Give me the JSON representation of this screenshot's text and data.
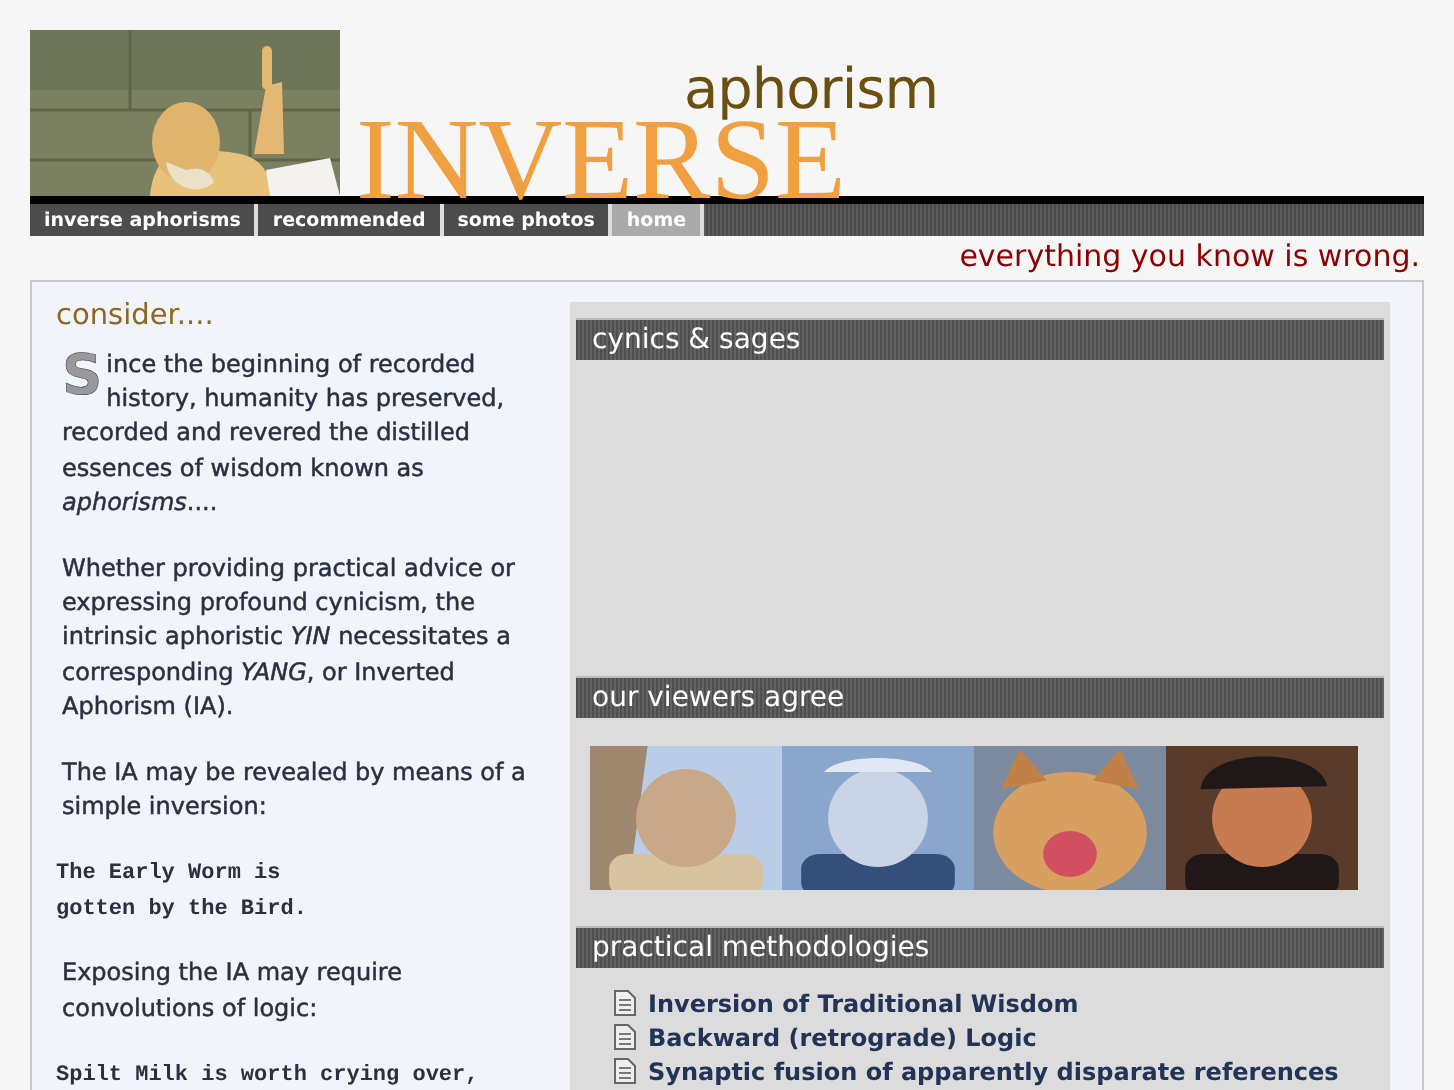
{
  "header": {
    "logo_small": "aphorism",
    "logo_large": "INVERSE",
    "tagline": "everything you know is wrong.",
    "nav": [
      {
        "label": "inverse aphorisms",
        "selected": false
      },
      {
        "label": "recommended",
        "selected": false
      },
      {
        "label": "some photos",
        "selected": false
      },
      {
        "label": "home",
        "selected": true
      }
    ]
  },
  "consider": {
    "title": "consider....",
    "paragraphs": [
      {
        "kind": "dropcap",
        "initial": "S",
        "text": "ince the beginning of recorded history, humanity has preserved, recorded and revered the distilled essences of wisdom known as *aphorisms*...."
      },
      {
        "kind": "text",
        "text": "Whether providing practical advice or expressing profound cynicism, the intrinsic aphoristic *YIN* necessitates a corresponding *YANG*, or Inverted Aphorism (IA)."
      },
      {
        "kind": "text",
        "text": "The IA may be revealed by means of a simple inversion:"
      },
      {
        "kind": "code",
        "lines": [
          "The Early Worm is",
          "gotten by the Bird."
        ]
      },
      {
        "kind": "text",
        "text": "Exposing the IA may require convolutions of logic:"
      },
      {
        "kind": "code",
        "lines": [
          "Spilt Milk is worth crying over,"
        ]
      }
    ]
  },
  "panels": [
    {
      "title": "cynics & sages",
      "kind": "empty"
    },
    {
      "title": "our viewers agree",
      "kind": "photos"
    },
    {
      "title": "practical methodologies",
      "kind": "links",
      "items": [
        "Inversion of Traditional Wisdom",
        "Backward (retrograde) Logic",
        "Synaptic fusion of apparently disparate references"
      ]
    }
  ]
}
